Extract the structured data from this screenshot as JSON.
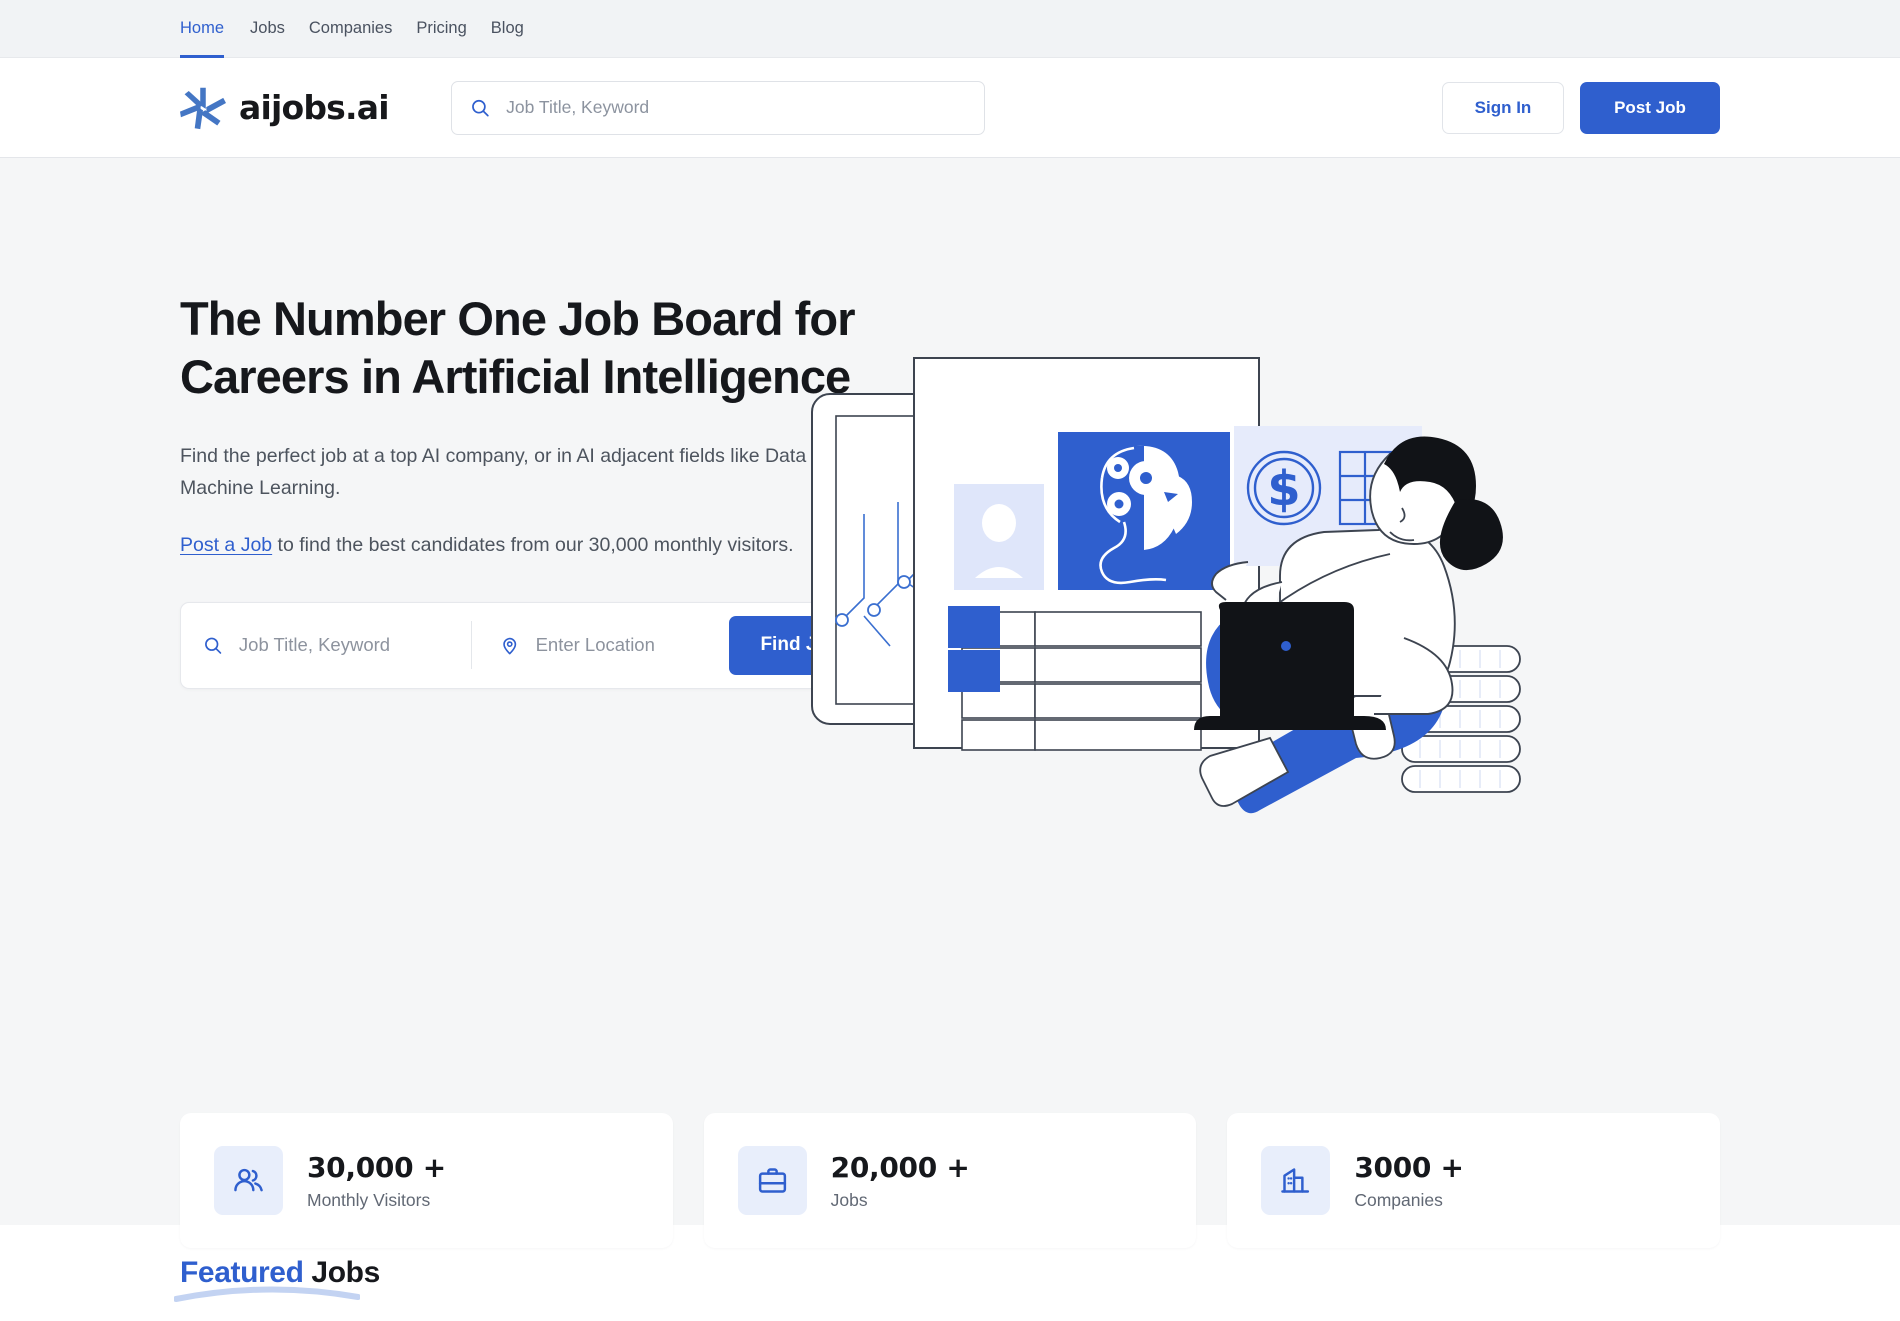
{
  "topnav": {
    "items": [
      {
        "label": "Home",
        "active": true
      },
      {
        "label": "Jobs",
        "active": false
      },
      {
        "label": "Companies",
        "active": false
      },
      {
        "label": "Pricing",
        "active": false
      },
      {
        "label": "Blog",
        "active": false
      }
    ]
  },
  "header": {
    "logo_text": "aijobs.ai",
    "logo_icon": "pinwheel-logo-icon",
    "search": {
      "icon": "search-icon",
      "placeholder": "Job Title, Keyword",
      "value": ""
    },
    "sign_in_label": "Sign In",
    "post_job_label": "Post Job"
  },
  "hero": {
    "title": "The Number One Job Board for Careers in Artificial Intelligence",
    "subtitle": "Find the perfect job at a top AI company, or in AI adjacent fields like Data Science and Machine Learning.",
    "note_link": "Post a Job",
    "note_rest": " to find the best candidates from our 30,000 monthly visitors.",
    "search": {
      "keyword_icon": "search-icon",
      "keyword_placeholder": "Job Title, Keyword",
      "keyword_value": "",
      "location_icon": "map-pin-icon",
      "location_placeholder": "Enter Location",
      "location_value": "",
      "submit_label": "Find Job Now"
    },
    "illustration_alt": "ai-job-board-illustration"
  },
  "stats": [
    {
      "icon": "users-icon",
      "value": "30,000 +",
      "label": "Monthly Visitors"
    },
    {
      "icon": "briefcase-icon",
      "value": "20,000 +",
      "label": "Jobs"
    },
    {
      "icon": "building-icon",
      "value": "3000 +",
      "label": "Companies"
    }
  ],
  "featured": {
    "highlight": "Featured",
    "rest": " Jobs"
  },
  "colors": {
    "accent": "#2f5fce",
    "accent_light": "#e8eefb",
    "text_dark": "#16181c",
    "text_muted": "#616874",
    "hero_bg": "#f5f6f7",
    "topbar_bg": "#f1f3f5"
  }
}
